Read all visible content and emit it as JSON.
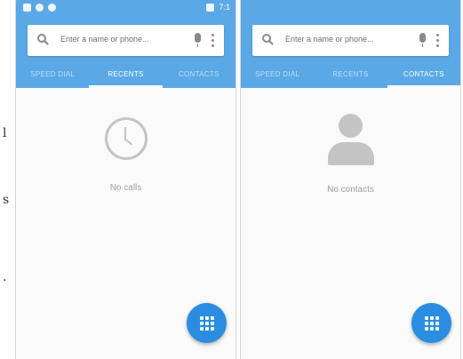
{
  "margin_chars": [
    "l",
    "s",
    "."
  ],
  "left_screen": {
    "status_time": "7:1",
    "search_placeholder": "Enter a name or phone...",
    "tabs": [
      "SPEED DIAL",
      "RECENTS",
      "CONTACTS"
    ],
    "active_tab": "RECENTS",
    "empty_message": "No calls",
    "empty_icon": "clock-icon"
  },
  "right_screen": {
    "search_placeholder": "Enter a name or phone...",
    "tabs": [
      "SPEED DIAL",
      "RECENTS",
      "CONTACTS"
    ],
    "active_tab": "CONTACTS",
    "empty_message": "No contacts",
    "empty_icon": "person-icon"
  },
  "colors": {
    "primary": "#5aa9e6",
    "fab": "#2b8de0"
  }
}
